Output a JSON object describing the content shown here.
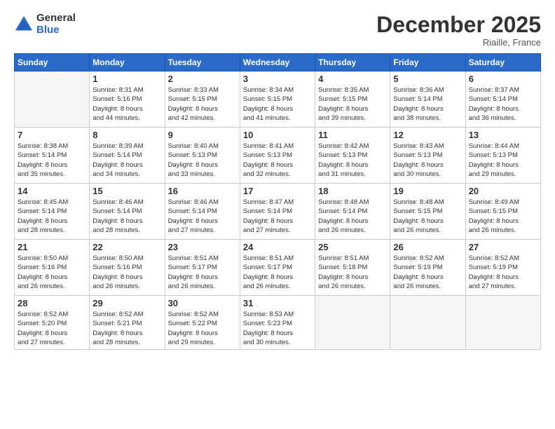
{
  "logo": {
    "general": "General",
    "blue": "Blue"
  },
  "title": "December 2025",
  "location": "Riaille, France",
  "days_header": [
    "Sunday",
    "Monday",
    "Tuesday",
    "Wednesday",
    "Thursday",
    "Friday",
    "Saturday"
  ],
  "weeks": [
    [
      {
        "num": "",
        "info": ""
      },
      {
        "num": "1",
        "info": "Sunrise: 8:31 AM\nSunset: 5:16 PM\nDaylight: 8 hours\nand 44 minutes."
      },
      {
        "num": "2",
        "info": "Sunrise: 8:33 AM\nSunset: 5:15 PM\nDaylight: 8 hours\nand 42 minutes."
      },
      {
        "num": "3",
        "info": "Sunrise: 8:34 AM\nSunset: 5:15 PM\nDaylight: 8 hours\nand 41 minutes."
      },
      {
        "num": "4",
        "info": "Sunrise: 8:35 AM\nSunset: 5:15 PM\nDaylight: 8 hours\nand 39 minutes."
      },
      {
        "num": "5",
        "info": "Sunrise: 8:36 AM\nSunset: 5:14 PM\nDaylight: 8 hours\nand 38 minutes."
      },
      {
        "num": "6",
        "info": "Sunrise: 8:37 AM\nSunset: 5:14 PM\nDaylight: 8 hours\nand 36 minutes."
      }
    ],
    [
      {
        "num": "7",
        "info": "Sunrise: 8:38 AM\nSunset: 5:14 PM\nDaylight: 8 hours\nand 35 minutes."
      },
      {
        "num": "8",
        "info": "Sunrise: 8:39 AM\nSunset: 5:14 PM\nDaylight: 8 hours\nand 34 minutes."
      },
      {
        "num": "9",
        "info": "Sunrise: 8:40 AM\nSunset: 5:13 PM\nDaylight: 8 hours\nand 33 minutes."
      },
      {
        "num": "10",
        "info": "Sunrise: 8:41 AM\nSunset: 5:13 PM\nDaylight: 8 hours\nand 32 minutes."
      },
      {
        "num": "11",
        "info": "Sunrise: 8:42 AM\nSunset: 5:13 PM\nDaylight: 8 hours\nand 31 minutes."
      },
      {
        "num": "12",
        "info": "Sunrise: 8:43 AM\nSunset: 5:13 PM\nDaylight: 8 hours\nand 30 minutes."
      },
      {
        "num": "13",
        "info": "Sunrise: 8:44 AM\nSunset: 5:13 PM\nDaylight: 8 hours\nand 29 minutes."
      }
    ],
    [
      {
        "num": "14",
        "info": "Sunrise: 8:45 AM\nSunset: 5:14 PM\nDaylight: 8 hours\nand 28 minutes."
      },
      {
        "num": "15",
        "info": "Sunrise: 8:46 AM\nSunset: 5:14 PM\nDaylight: 8 hours\nand 28 minutes."
      },
      {
        "num": "16",
        "info": "Sunrise: 8:46 AM\nSunset: 5:14 PM\nDaylight: 8 hours\nand 27 minutes."
      },
      {
        "num": "17",
        "info": "Sunrise: 8:47 AM\nSunset: 5:14 PM\nDaylight: 8 hours\nand 27 minutes."
      },
      {
        "num": "18",
        "info": "Sunrise: 8:48 AM\nSunset: 5:14 PM\nDaylight: 8 hours\nand 26 minutes."
      },
      {
        "num": "19",
        "info": "Sunrise: 8:48 AM\nSunset: 5:15 PM\nDaylight: 8 hours\nand 26 minutes."
      },
      {
        "num": "20",
        "info": "Sunrise: 8:49 AM\nSunset: 5:15 PM\nDaylight: 8 hours\nand 26 minutes."
      }
    ],
    [
      {
        "num": "21",
        "info": "Sunrise: 8:50 AM\nSunset: 5:16 PM\nDaylight: 8 hours\nand 26 minutes."
      },
      {
        "num": "22",
        "info": "Sunrise: 8:50 AM\nSunset: 5:16 PM\nDaylight: 8 hours\nand 26 minutes."
      },
      {
        "num": "23",
        "info": "Sunrise: 8:51 AM\nSunset: 5:17 PM\nDaylight: 8 hours\nand 26 minutes."
      },
      {
        "num": "24",
        "info": "Sunrise: 8:51 AM\nSunset: 5:17 PM\nDaylight: 8 hours\nand 26 minutes."
      },
      {
        "num": "25",
        "info": "Sunrise: 8:51 AM\nSunset: 5:18 PM\nDaylight: 8 hours\nand 26 minutes."
      },
      {
        "num": "26",
        "info": "Sunrise: 8:52 AM\nSunset: 5:19 PM\nDaylight: 8 hours\nand 26 minutes."
      },
      {
        "num": "27",
        "info": "Sunrise: 8:52 AM\nSunset: 5:19 PM\nDaylight: 8 hours\nand 27 minutes."
      }
    ],
    [
      {
        "num": "28",
        "info": "Sunrise: 8:52 AM\nSunset: 5:20 PM\nDaylight: 8 hours\nand 27 minutes."
      },
      {
        "num": "29",
        "info": "Sunrise: 8:52 AM\nSunset: 5:21 PM\nDaylight: 8 hours\nand 28 minutes."
      },
      {
        "num": "30",
        "info": "Sunrise: 8:52 AM\nSunset: 5:22 PM\nDaylight: 8 hours\nand 29 minutes."
      },
      {
        "num": "31",
        "info": "Sunrise: 8:53 AM\nSunset: 5:23 PM\nDaylight: 8 hours\nand 30 minutes."
      },
      {
        "num": "",
        "info": ""
      },
      {
        "num": "",
        "info": ""
      },
      {
        "num": "",
        "info": ""
      }
    ]
  ]
}
